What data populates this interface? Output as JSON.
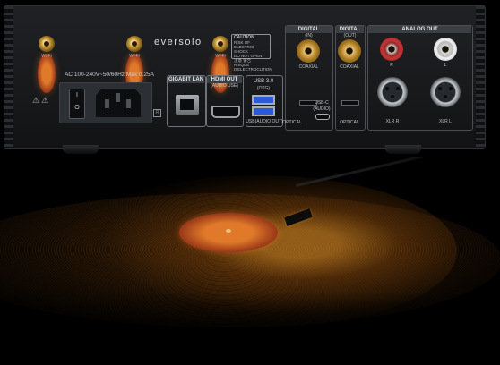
{
  "device": {
    "brand": "eversolo",
    "caution": {
      "title": "CAUTION",
      "line1": "RISK OF ELECTRIC SHOCK",
      "line2": "DO NOT OPEN",
      "line3": "注意 警告",
      "line4": "RISQUE D'ELECTROCUTION"
    },
    "power_spec": "AC 100-240V~50/60Hz Max 0.25A",
    "wifi_label": "Wi-Fi",
    "ports": {
      "gigabit_lan": "GIGABIT LAN",
      "hdmi_out": "HDMI OUT",
      "hdmi_sub": "(AUDIO USE)",
      "usb3": "USB 3.0",
      "usb3_sub": "(OTG)",
      "usb_audio_out": "USB(AUDIO OUT)",
      "usb_c": "USB-C",
      "usb_c_sub": "(AUDIO)",
      "digital_in": "DIGITAL",
      "digital_in_sub": "(IN)",
      "digital_out": "DIGITAL",
      "digital_out_sub": "(OUT)",
      "coaxial_in": "COAXIAL",
      "coaxial_out": "COAXIAL",
      "optical_in": "OPTICAL",
      "optical_out": "OPTICAL",
      "analog_out": "ANALOG OUT",
      "r_label": "R",
      "l_label": "L",
      "xlr_r": "XLR R",
      "xlr_l": "XLR L"
    }
  },
  "colors": {
    "panel": "#1a1c1f",
    "record_glow": "#e0962a",
    "record_label": "#c65a22"
  }
}
